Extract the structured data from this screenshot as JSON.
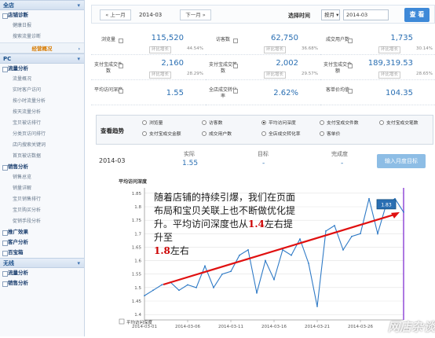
{
  "sidebar": {
    "all_store": "全店",
    "store_diagnosis": "店铺诊断",
    "health_daily": "健康日报",
    "search_traffic_diag": "搜索流量诊断",
    "business_module": "经营概况",
    "pc": "PC",
    "traffic_analysis": "流量分析",
    "traffic_items": [
      "流量概况",
      "实时客户访问",
      "按小时流量分析",
      "按天流量分析",
      "宝贝被访排行",
      "分类页访问排行",
      "店内搜索关键词",
      "首页被访数据"
    ],
    "sales_analysis": "销售分析",
    "sales_items": [
      "销售总览",
      "销量详解",
      "宝贝销售排行",
      "宝贝购买分析",
      "促销手段分析"
    ],
    "promo_effect": "推广效果",
    "customer_analysis": "客户分析",
    "treasure_box": "百宝箱",
    "wireless": "无线",
    "wl_traffic": "流量分析",
    "wl_sales": "销售分析"
  },
  "topbar": {
    "prev": "« 上一月",
    "current": "2014-03",
    "next": "下一月 »",
    "pick_time": "选择时间",
    "mode": "按月",
    "date": "2014-03",
    "search": "查 看"
  },
  "metrics": [
    {
      "label": "浏览量",
      "value": "115,520",
      "tag": "环比增长",
      "pct": "44.54%"
    },
    {
      "label": "访客数",
      "value": "62,750",
      "tag": "环比增长",
      "pct": "36.68%"
    },
    {
      "label": "成交用户数",
      "value": "1,735",
      "tag": "环比增长",
      "pct": "30.14%"
    },
    {
      "label": "支付宝成交件数",
      "value": "2,160",
      "tag": "环比增长",
      "pct": "28.29%"
    },
    {
      "label": "支付宝成交笔数",
      "value": "2,002",
      "tag": "环比增长",
      "pct": "29.57%"
    },
    {
      "label": "支付宝成交金额",
      "value": "189,319.53",
      "tag": "环比增长",
      "pct": "28.65%"
    },
    {
      "label": "平均访问深度",
      "value": "1.55"
    },
    {
      "label": "全店成交转化率",
      "value": "2.62%"
    },
    {
      "label": "客单价均值",
      "value": "104.35"
    }
  ],
  "trend": {
    "title": "查看趋势",
    "options": [
      "浏览量",
      "访客数",
      "平均访问深度",
      "支付宝成交件数",
      "支付宝成交笔数",
      "支付宝成交金额",
      "成交用户数",
      "全店成交转化率",
      "客单价"
    ]
  },
  "summary": {
    "month": "2014-03",
    "h_actual": "实际",
    "v_actual": "1.55",
    "h_target": "目标",
    "v_target": "-",
    "h_done": "完成度",
    "v_done": "-",
    "plan_btn": "输入月度目标"
  },
  "annotation": {
    "l1": "随着店铺的持续引爆，我们在页面布局和宝贝关联上也不断做优化提升。平均访问深度也从",
    "hi1": "1.4",
    "l2": "左右提升至",
    "hi2": "1.8",
    "l3": "左右"
  },
  "watermark": "网店杂谈",
  "chart_data": {
    "type": "line",
    "title": "平均访问深度",
    "x_tick_labels": [
      "2014-03-01",
      "2014-03-06",
      "2014-03-11",
      "2014-03-16",
      "2014-03-21",
      "2014-03-26"
    ],
    "x": [
      1,
      2,
      3,
      4,
      5,
      6,
      7,
      8,
      9,
      10,
      11,
      12,
      13,
      14,
      15,
      16,
      17,
      18,
      19,
      20,
      21,
      22,
      23,
      24,
      25,
      26,
      27,
      28,
      29,
      30,
      31
    ],
    "y_ticks": [
      1.4,
      1.45,
      1.5,
      1.55,
      1.6,
      1.65,
      1.7,
      1.75,
      1.8,
      1.85
    ],
    "ylim": [
      1.38,
      1.87
    ],
    "series": [
      {
        "name": "平均访问深度",
        "values": [
          1.47,
          1.49,
          1.51,
          1.52,
          1.49,
          1.51,
          1.5,
          1.58,
          1.5,
          1.55,
          1.56,
          1.62,
          1.64,
          1.48,
          1.6,
          1.53,
          1.64,
          1.62,
          1.68,
          1.59,
          1.43,
          1.71,
          1.73,
          1.64,
          1.69,
          1.7,
          1.83,
          1.7,
          1.81,
          1.83,
          1.78
        ]
      }
    ],
    "tooltip_value": "1.83",
    "highlight_index": 30,
    "legend": "bottom-left",
    "grid": true
  }
}
